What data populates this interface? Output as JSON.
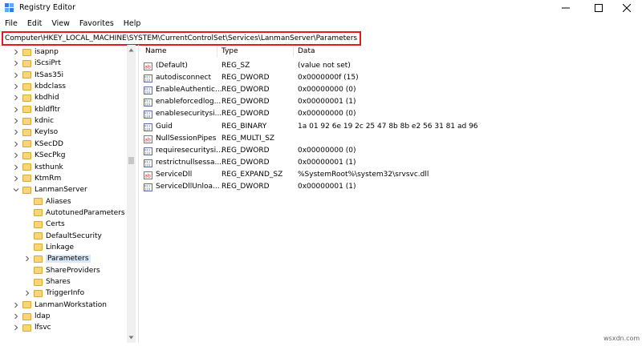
{
  "window": {
    "title": "Registry Editor",
    "minimize": "─",
    "maximize": "☐",
    "close": "✕"
  },
  "menu": [
    "File",
    "Edit",
    "View",
    "Favorites",
    "Help"
  ],
  "address": "Computer\\HKEY_LOCAL_MACHINE\\SYSTEM\\CurrentControlSet\\Services\\LanmanServer\\Parameters",
  "tree": [
    {
      "label": "isapnp",
      "level": 0,
      "expand": "right"
    },
    {
      "label": "iScsiPrt",
      "level": 0,
      "expand": "right"
    },
    {
      "label": "ItSas35i",
      "level": 0,
      "expand": "right"
    },
    {
      "label": "kbdclass",
      "level": 0,
      "expand": "right"
    },
    {
      "label": "kbdhid",
      "level": 0,
      "expand": "right"
    },
    {
      "label": "kbldfltr",
      "level": 0,
      "expand": "right"
    },
    {
      "label": "kdnic",
      "level": 0,
      "expand": "right"
    },
    {
      "label": "KeyIso",
      "level": 0,
      "expand": "right"
    },
    {
      "label": "KSecDD",
      "level": 0,
      "expand": "right"
    },
    {
      "label": "KSecPkg",
      "level": 0,
      "expand": "right"
    },
    {
      "label": "ksthunk",
      "level": 0,
      "expand": "right"
    },
    {
      "label": "KtmRm",
      "level": 0,
      "expand": "right"
    },
    {
      "label": "LanmanServer",
      "level": 0,
      "expand": "down"
    },
    {
      "label": "Aliases",
      "level": 1,
      "expand": "none"
    },
    {
      "label": "AutotunedParameters",
      "level": 1,
      "expand": "none"
    },
    {
      "label": "Certs",
      "level": 1,
      "expand": "none"
    },
    {
      "label": "DefaultSecurity",
      "level": 1,
      "expand": "none"
    },
    {
      "label": "Linkage",
      "level": 1,
      "expand": "none"
    },
    {
      "label": "Parameters",
      "level": 1,
      "expand": "right",
      "selected": true
    },
    {
      "label": "ShareProviders",
      "level": 1,
      "expand": "none"
    },
    {
      "label": "Shares",
      "level": 1,
      "expand": "none"
    },
    {
      "label": "TriggerInfo",
      "level": 1,
      "expand": "right"
    },
    {
      "label": "LanmanWorkstation",
      "level": 0,
      "expand": "right"
    },
    {
      "label": "ldap",
      "level": 0,
      "expand": "right"
    },
    {
      "label": "lfsvc",
      "level": 0,
      "expand": "right"
    }
  ],
  "columns": {
    "name": "Name",
    "type": "Type",
    "data": "Data"
  },
  "values": [
    {
      "icon": "string-value-icon",
      "name": "(Default)",
      "type": "REG_SZ",
      "data": "(value not set)"
    },
    {
      "icon": "binary-value-icon",
      "name": "autodisconnect",
      "type": "REG_DWORD",
      "data": "0x0000000f (15)"
    },
    {
      "icon": "binary-value-icon",
      "name": "EnableAuthentic...",
      "type": "REG_DWORD",
      "data": "0x00000000 (0)"
    },
    {
      "icon": "binary-value-icon",
      "name": "enableforcedlog...",
      "type": "REG_DWORD",
      "data": "0x00000001 (1)"
    },
    {
      "icon": "binary-value-icon",
      "name": "enablesecuritysi...",
      "type": "REG_DWORD",
      "data": "0x00000000 (0)"
    },
    {
      "icon": "binary-value-icon",
      "name": "Guid",
      "type": "REG_BINARY",
      "data": "1a 01 92 6e 19 2c 25 47 8b 8b e2 56 31 81 ad 96"
    },
    {
      "icon": "string-value-icon",
      "name": "NullSessionPipes",
      "type": "REG_MULTI_SZ",
      "data": ""
    },
    {
      "icon": "binary-value-icon",
      "name": "requiresecuritysi...",
      "type": "REG_DWORD",
      "data": "0x00000000 (0)"
    },
    {
      "icon": "binary-value-icon",
      "name": "restrictnullsessa...",
      "type": "REG_DWORD",
      "data": "0x00000001 (1)"
    },
    {
      "icon": "string-value-icon",
      "name": "ServiceDll",
      "type": "REG_EXPAND_SZ",
      "data": "%SystemRoot%\\system32\\srvsvc.dll"
    },
    {
      "icon": "binary-value-icon",
      "name": "ServiceDllUnloa...",
      "type": "REG_DWORD",
      "data": "0x00000001 (1)"
    }
  ],
  "watermark": "wsxdn.com",
  "colors": {
    "highlight": "#e8161d",
    "folder": "#f5d67a",
    "selection": "#d9e8f7"
  }
}
